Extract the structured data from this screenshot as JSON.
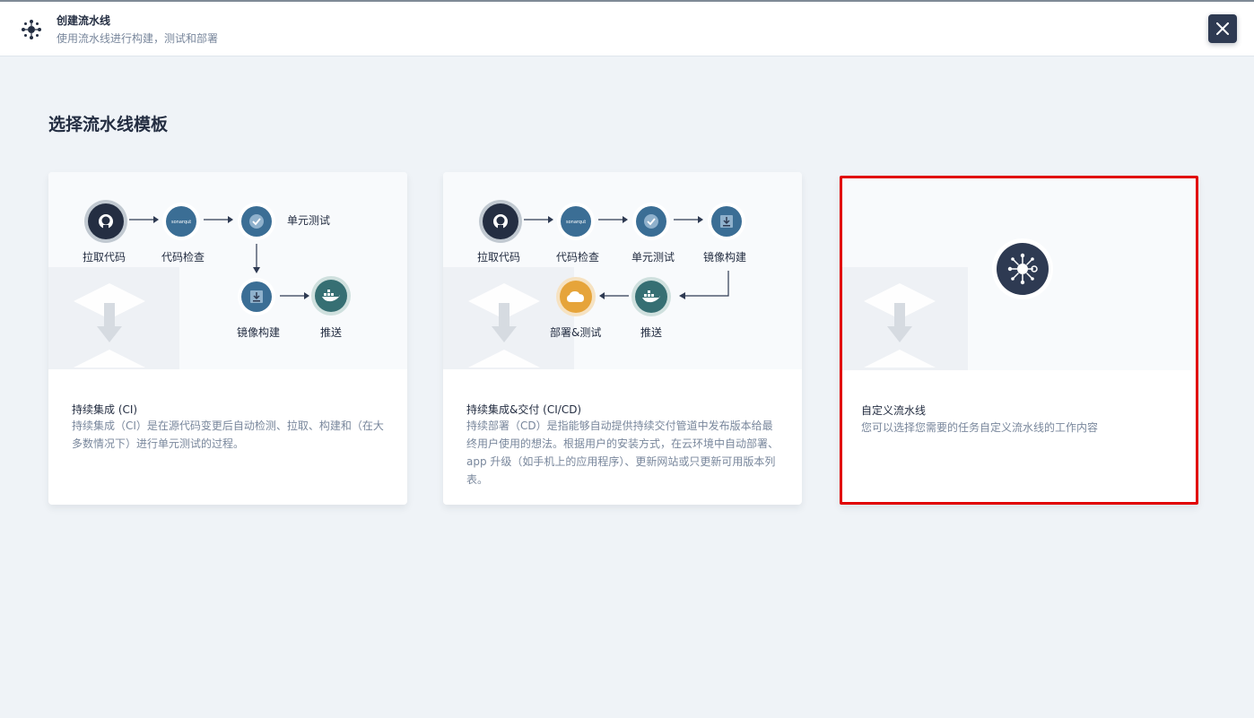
{
  "header": {
    "title": "创建流水线",
    "subtitle": "使用流水线进行构建，测试和部署",
    "close_icon": "close-icon"
  },
  "page_title": "选择流水线模板",
  "cards": [
    {
      "title": "持续集成 (CI)",
      "description": "持续集成（CI）是在源代码变更后自动检测、拉取、构建和（在大多数情况下）进行单元测试的过程。",
      "steps": [
        "拉取代码",
        "代码检查",
        "单元测试",
        "镜像构建",
        "推送"
      ]
    },
    {
      "title": "持续集成&交付 (CI/CD)",
      "description": "持续部署（CD）是指能够自动提供持续交付管道中发布版本给最终用户使用的想法。根据用户的安装方式，在云环境中自动部署、app 升级（如手机上的应用程序）、更新网站或只更新可用版本列表。",
      "steps": [
        "拉取代码",
        "代码检查",
        "单元测试",
        "镜像构建",
        "部署&测试",
        "推送"
      ]
    },
    {
      "title": "自定义流水线",
      "description": "您可以选择您需要的任务自定义流水线的工作内容",
      "selected": true
    }
  ],
  "colors": {
    "accent": "#242e42",
    "node_blue": "#3b6e95",
    "node_teal": "#366f73",
    "node_orange": "#e6a43a",
    "selection": "#e10000"
  }
}
